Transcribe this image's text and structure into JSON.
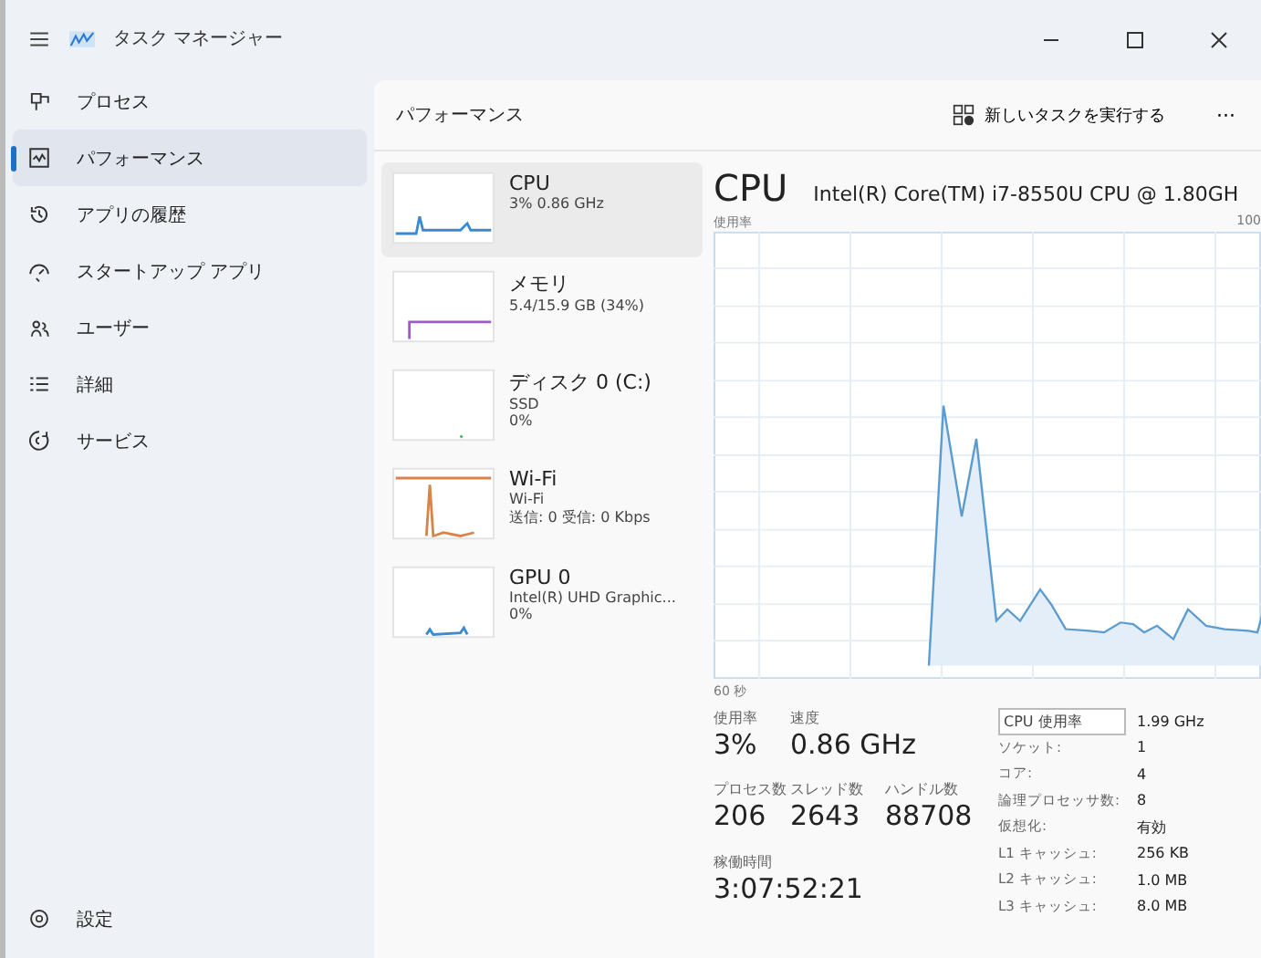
{
  "window": {
    "title": "タスク マネージャー"
  },
  "sidebar": {
    "items": [
      {
        "label": "プロセス",
        "selected": false
      },
      {
        "label": "パフォーマンス",
        "selected": true
      },
      {
        "label": "アプリの履歴",
        "selected": false
      },
      {
        "label": "スタートアップ アプリ",
        "selected": false
      },
      {
        "label": "ユーザー",
        "selected": false
      },
      {
        "label": "詳細",
        "selected": false
      },
      {
        "label": "サービス",
        "selected": false
      }
    ],
    "footer": {
      "label": "設定"
    }
  },
  "header": {
    "title": "パフォーマンス",
    "run_task": "新しいタスクを実行する",
    "more": "···"
  },
  "devices": [
    {
      "name": "CPU",
      "lines": [
        "3% 0.86 GHz"
      ],
      "color": "#3a8ad0",
      "selected": true
    },
    {
      "name": "メモリ",
      "lines": [
        "5.4/15.9 GB (34%)"
      ],
      "color": "#9a5cc0",
      "selected": false
    },
    {
      "name": "ディスク 0 (C:)",
      "lines": [
        "SSD",
        "0%"
      ],
      "color": "#4caf50",
      "selected": false
    },
    {
      "name": "Wi-Fi",
      "lines": [
        "Wi-Fi",
        "送信: 0 受信: 0 Kbps"
      ],
      "color": "#d9824a",
      "selected": false
    },
    {
      "name": "GPU 0",
      "lines": [
        "Intel(R) UHD Graphic...",
        "0%"
      ],
      "color": "#3a8ad0",
      "selected": false
    }
  ],
  "detail": {
    "title": "CPU",
    "model": "Intel(R) Core(TM) i7-8550U CPU @ 1.80GH",
    "graph_label": "使用率",
    "graph_max": "100",
    "graph_span": "60 秒",
    "stats": [
      {
        "label": "使用率",
        "value": "3%"
      },
      {
        "label": "速度",
        "value": "0.86 GHz"
      },
      {
        "label": "プロセス数",
        "value": "206"
      },
      {
        "label": "スレッド数",
        "value": "2643"
      },
      {
        "label": "ハンドル数",
        "value": "88708"
      },
      {
        "label": "稼働時間",
        "value": "3:07:52:21"
      }
    ],
    "tooltip": "CPU 使用率",
    "specs": [
      {
        "value": "1.99 GHz"
      },
      {
        "label": "ソケット:",
        "value": "1"
      },
      {
        "label": "コア:",
        "value": "4"
      },
      {
        "label": "論理プロセッサ数:",
        "value": "8"
      },
      {
        "label": "仮想化:",
        "value": "有効"
      },
      {
        "label": "L1 キャッシュ:",
        "value": "256 KB"
      },
      {
        "label": "L2 キャッシュ:",
        "value": "1.0 MB"
      },
      {
        "label": "L3 キャッシュ:",
        "value": "8.0 MB"
      }
    ]
  }
}
